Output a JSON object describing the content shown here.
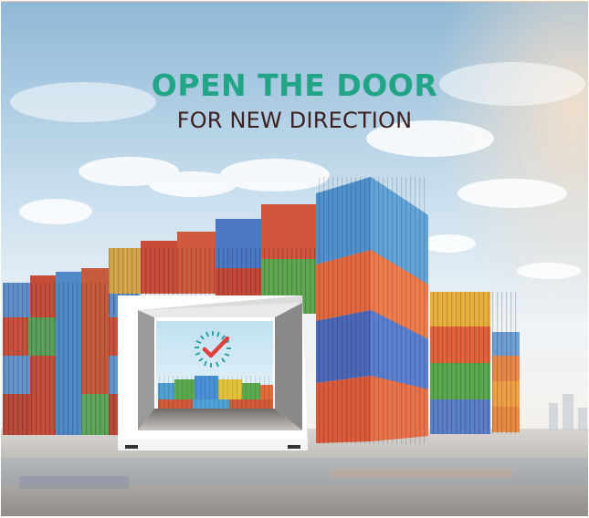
{
  "headline": {
    "line1": "OPEN THE DOOR",
    "line2": "FOR NEW DIRECTION"
  },
  "colors": {
    "headline_accent": "#22a487",
    "headline_dark": "#3d2020",
    "sky_top": "#9fc3dc",
    "ground": "#b9b6b2",
    "check_mark": "#e0403f",
    "dial_ticks": "#2aa2a6"
  },
  "icons": {
    "container_door_frame": "open-door-frame-icon",
    "check_dial": "check-dial-icon"
  }
}
